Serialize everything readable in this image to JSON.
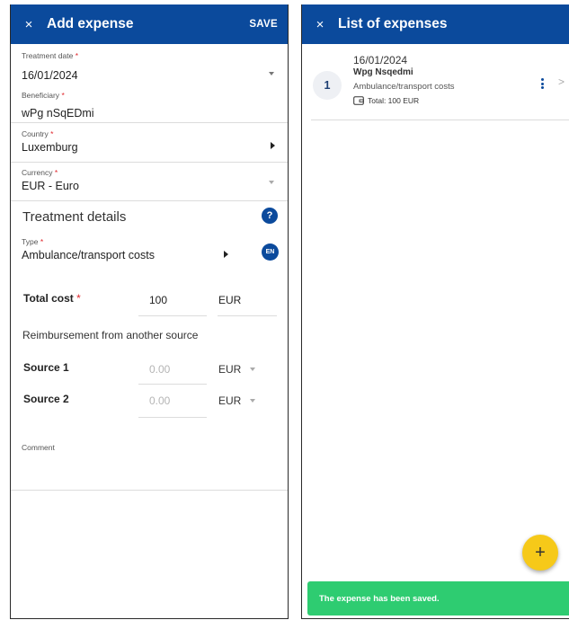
{
  "left": {
    "header": {
      "close_glyph": "×",
      "title": "Add expense",
      "save": "SAVE"
    },
    "treatment_date": {
      "label": "Treatment date",
      "value": "16/01/2024"
    },
    "beneficiary": {
      "label": "Beneficiary",
      "value": "wPg nSqEDmi"
    },
    "country": {
      "label": "Country",
      "value": "Luxemburg"
    },
    "currency": {
      "label": "Currency",
      "value": "EUR - Euro"
    },
    "required_mark": "*",
    "details": {
      "title": "Treatment details",
      "help_glyph": "?",
      "type_label": "Type",
      "type_value": "Ambulance/transport costs",
      "lang_badge": "EN",
      "total_cost_label": "Total cost",
      "total_cost_value": "100",
      "total_cost_currency": "EUR",
      "reimbursement_label": "Reimbursement from another source",
      "source1": {
        "label": "Source 1",
        "placeholder": "0.00",
        "currency": "EUR"
      },
      "source2": {
        "label": "Source 2",
        "placeholder": "0.00",
        "currency": "EUR"
      },
      "comment_label": "Comment"
    }
  },
  "right": {
    "header": {
      "close_glyph": "×",
      "title": "List of expenses"
    },
    "expenses": [
      {
        "index": "1",
        "date": "16/01/2024",
        "name": "Wpg Nsqedmi",
        "type": "Ambulance/transport costs",
        "total": "Total: 100 EUR"
      }
    ],
    "fab_glyph": "+",
    "toast": "The expense has been saved."
  },
  "colors": {
    "header_blue": "#0b4a9c",
    "required_red": "#e0282e",
    "fab_yellow": "#f6c919",
    "toast_green": "#2ecc71"
  }
}
